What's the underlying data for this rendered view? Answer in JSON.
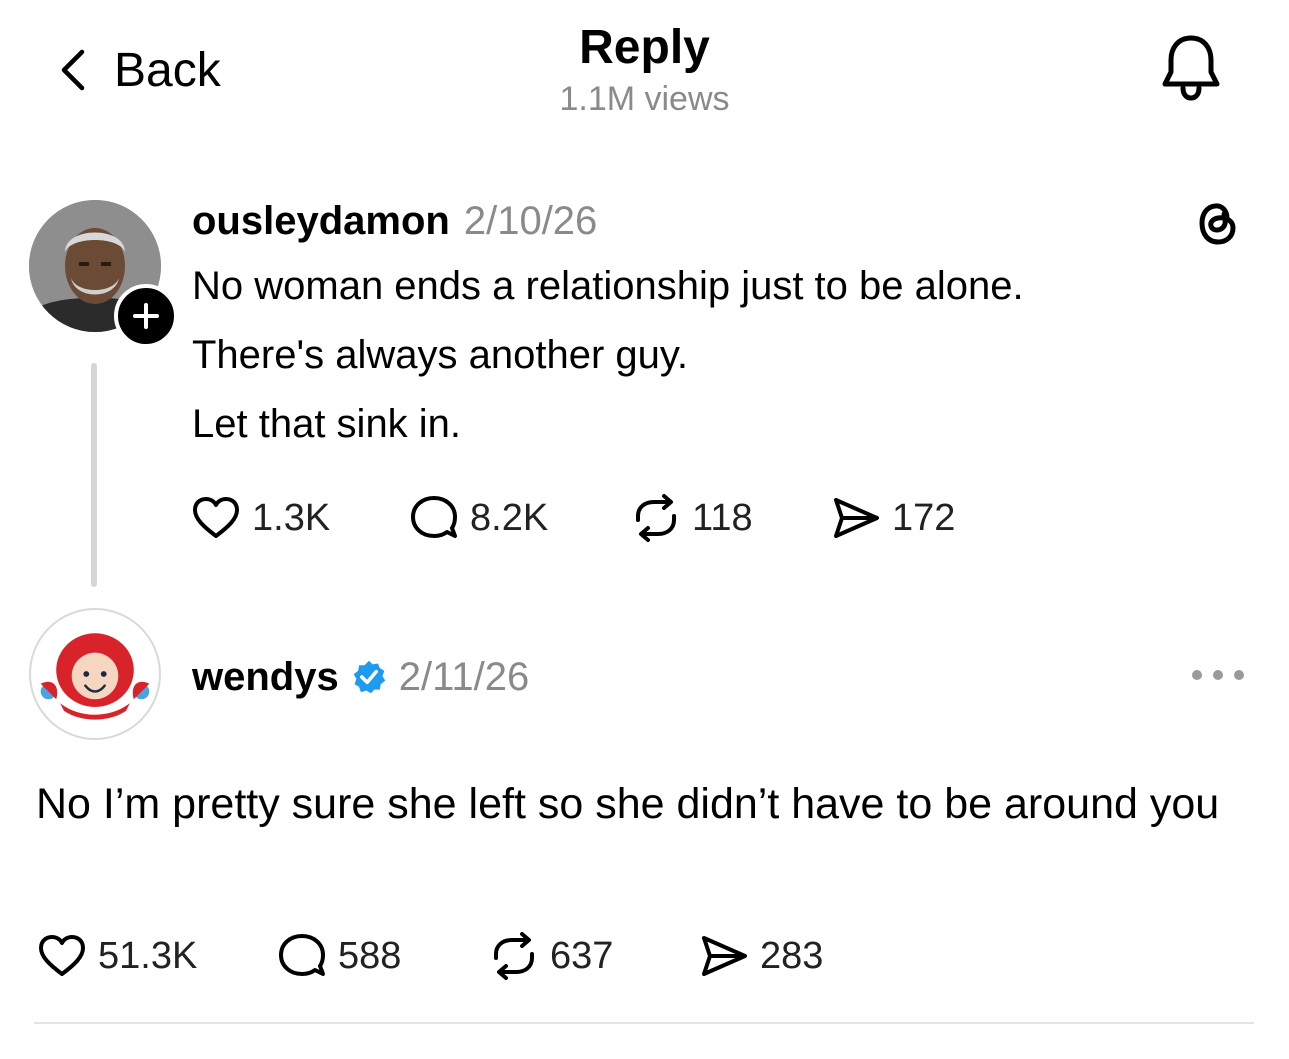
{
  "header": {
    "back_label": "Back",
    "title": "Reply",
    "views": "1.1M views"
  },
  "icons": {
    "back": "chevron-left-icon",
    "bell": "bell-icon",
    "threads": "threads-logo-icon",
    "like": "heart-icon",
    "comment": "comment-bubble-icon",
    "repost": "repost-icon",
    "share": "send-icon",
    "more": "more-icon",
    "verified": "verified-badge-icon",
    "follow": "plus-icon"
  },
  "colors": {
    "text": "#000000",
    "muted": "#8a8a8a",
    "verified": "#1d9bf0",
    "thread_line": "#d6d6d6"
  },
  "original_post": {
    "username": "ousleydamon",
    "date": "2/10/26",
    "lines": [
      "No woman ends a relationship just to be alone.",
      "There's always another guy.",
      "Let that sink in."
    ],
    "stats": {
      "likes": "1.3K",
      "comments": "8.2K",
      "reposts": "118",
      "shares": "172"
    }
  },
  "reply_post": {
    "username": "wendys",
    "verified": true,
    "date": "2/11/26",
    "text": "No I’m pretty sure she left so she didn’t have to be around you",
    "stats": {
      "likes": "51.3K",
      "comments": "588",
      "reposts": "637",
      "shares": "283"
    }
  }
}
